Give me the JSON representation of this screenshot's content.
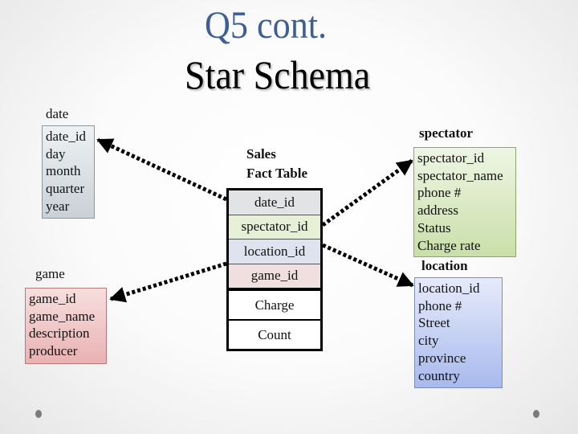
{
  "title": {
    "line1": "Q5 cont.",
    "line2": "Star Schema"
  },
  "colors": {
    "title_accent": "#3f5f92",
    "date_fill": "#d9dfe3",
    "game_fill": "#f0c8c9",
    "spectator_fill": "#dbe9c6",
    "location_fill": "#c4d0f3"
  },
  "fact_table": {
    "title_line1": "Sales",
    "title_line2": "Fact Table",
    "keys": [
      "date_id",
      "spectator_id",
      "location_id",
      "game_id"
    ],
    "measures": [
      "Charge",
      "Count"
    ]
  },
  "dimensions": {
    "date": {
      "label": "date",
      "fields": [
        "date_id",
        "day",
        "month",
        "quarter",
        "year"
      ]
    },
    "game": {
      "label": "game",
      "fields": [
        "game_id",
        "game_name",
        "description",
        "producer"
      ]
    },
    "spectator": {
      "label": "spectator",
      "fields": [
        "spectator_id",
        "spectator_name",
        "phone #",
        "address",
        "Status",
        "Charge rate"
      ]
    },
    "location": {
      "label": "location",
      "fields": [
        "location_id",
        "phone #",
        "Street",
        "city",
        "province",
        "country"
      ]
    }
  },
  "relationships": [
    {
      "from": "fact_table.date_id",
      "to": "date.date_id"
    },
    {
      "from": "fact_table.game_id",
      "to": "game.game_id"
    },
    {
      "from": "fact_table.spectator_id",
      "to": "spectator.spectator_id"
    },
    {
      "from": "fact_table.location_id",
      "to": "location.location_id"
    }
  ]
}
